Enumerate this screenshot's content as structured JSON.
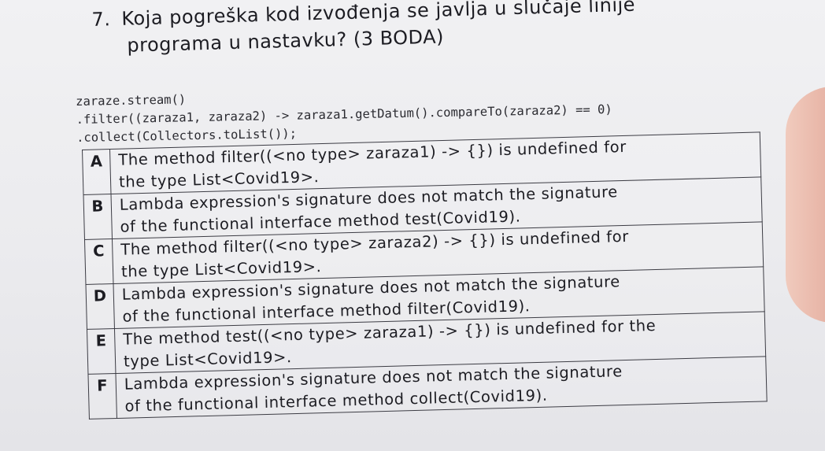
{
  "question": {
    "number": "7.",
    "line1": "Koja pogreška kod izvođenja se javlja u slučaje linije",
    "line2": "programa u nastavku? (3 BODA)"
  },
  "code_lines": [
    "zaraze.stream()",
    ".filter((zaraza1, zaraza2) -> zaraza1.getDatum().compareTo(zaraza2) == 0)",
    ".collect(Collectors.toList());"
  ],
  "options": [
    {
      "letter": "A",
      "line1": "The method filter((<no type> zaraza1) -> {}) is undefined for",
      "line2": "the type List<Covid19>."
    },
    {
      "letter": "B",
      "line1": "Lambda expression's signature does not match the signature",
      "line2": "of the functional interface method test(Covid19)."
    },
    {
      "letter": "C",
      "line1": "The method filter((<no type> zaraza2) -> {}) is undefined for",
      "line2": "the type List<Covid19>."
    },
    {
      "letter": "D",
      "line1": "Lambda expression's signature does not match the signature",
      "line2": "of the functional interface method filter(Covid19)."
    },
    {
      "letter": "E",
      "line1": "The method test((<no type> zaraza1) -> {}) is undefined for the",
      "line2": "type List<Covid19>."
    },
    {
      "letter": "F",
      "line1": "Lambda expression's signature does not match the signature",
      "line2": "of the functional interface method collect(Covid19)."
    }
  ]
}
